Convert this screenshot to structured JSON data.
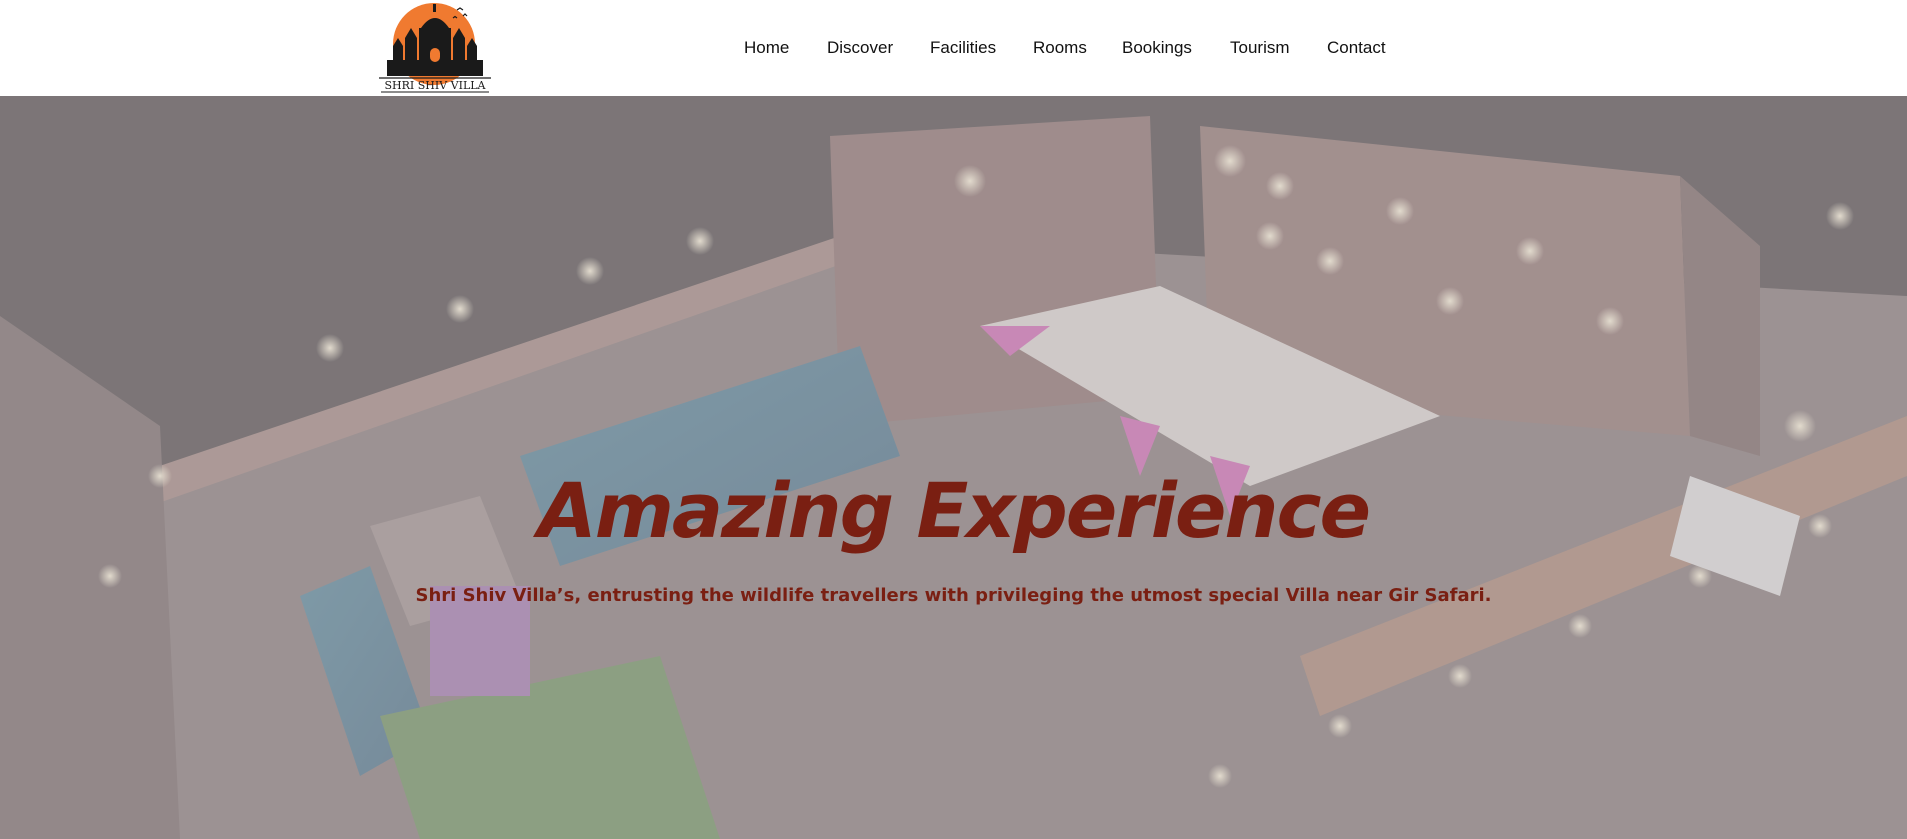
{
  "brand": {
    "name": "SHRI SHIV VILLA",
    "accent_color": "#7a1f12",
    "logo_sun_color": "#f07a30",
    "logo_silhouette_color": "#1a1a1a"
  },
  "nav": {
    "items": [
      {
        "label": "Home"
      },
      {
        "label": "Discover"
      },
      {
        "label": "Facilities"
      },
      {
        "label": "Rooms"
      },
      {
        "label": "Bookings"
      },
      {
        "label": "Tourism"
      },
      {
        "label": "Contact"
      }
    ]
  },
  "hero": {
    "title": "Amazing Experience",
    "subtitle": "Shri Shiv Villa’s, entrusting the wildlife travellers with privileging the utmost special Villa near Gir Safari.",
    "text_color": "#7a1f12",
    "background_image": "aerial-night-villa-photo"
  }
}
